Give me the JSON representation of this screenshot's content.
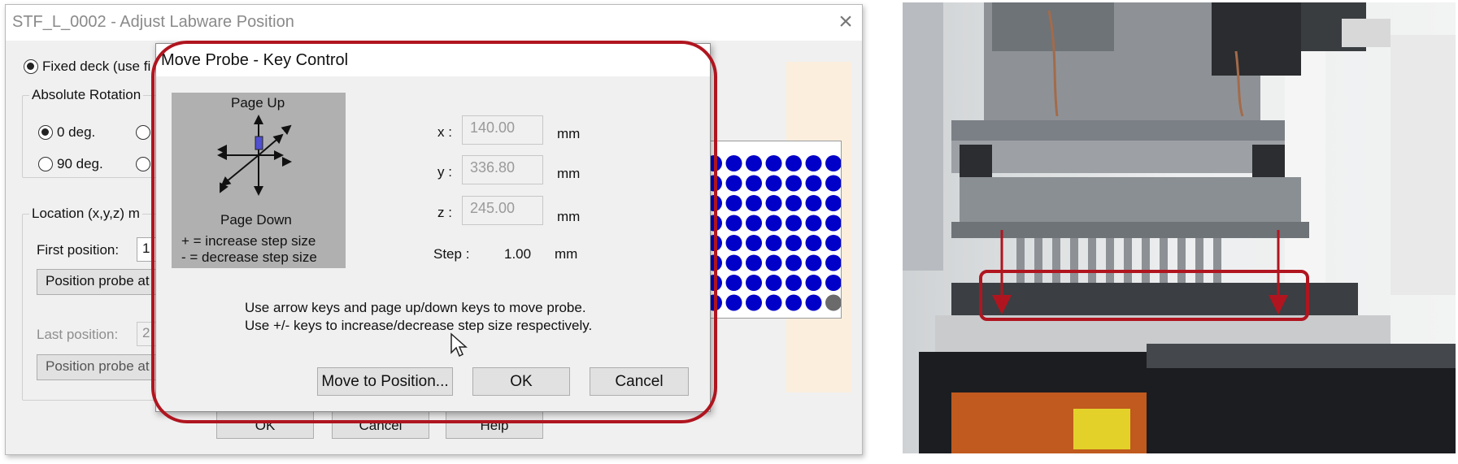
{
  "background_dialog": {
    "title": "STF_L_0002 - Adjust Labware Position",
    "fixed_deck_label": "Fixed deck (use fi",
    "rotation_group": "Absolute Rotation",
    "rotation_0": "0 deg.",
    "rotation_90": "90 deg.",
    "location_group": "Location (x,y,z) m",
    "first_position_label": "First position:",
    "first_position_value": "1",
    "position_probe_button_1": "Position probe at",
    "last_position_label": "Last position:",
    "last_position_value": "2",
    "position_probe_button_2": "Position probe at",
    "ok_label": "OK",
    "cancel_label": "Cancel",
    "help_label": "Help"
  },
  "probe_dialog": {
    "title": "Move Probe - Key Control",
    "keypad": {
      "page_up": "Page Up",
      "page_down": "Page Down",
      "increase_hint": "+ = increase step size",
      "decrease_hint": "- = decrease step size"
    },
    "coords": {
      "x_label": "x :",
      "x_value": "140.00",
      "x_unit": "mm",
      "y_label": "y :",
      "y_value": "336.80",
      "y_unit": "mm",
      "z_label": "z :",
      "z_value": "245.00",
      "z_unit": "mm"
    },
    "step_label": "Step :",
    "step_value": "1.00",
    "step_unit": "mm",
    "instruction_line1": "Use arrow keys and page up/down keys to move probe.",
    "instruction_line2": "Use +/- keys to increase/decrease step size respectively.",
    "move_button": "Move to Position...",
    "ok_button": "OK",
    "cancel_button": "Cancel"
  },
  "colors": {
    "highlight_red": "#b0151f",
    "well_blue": "#0000c8",
    "well_empty": "#6b6b6b"
  }
}
